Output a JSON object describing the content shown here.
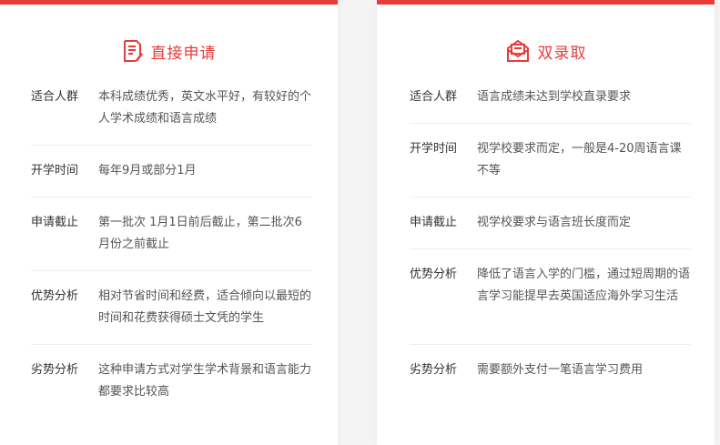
{
  "cards": [
    {
      "title": "直接申请",
      "icon": "application-form-icon",
      "rows": [
        {
          "label": "适合人群",
          "value": "本科成绩优秀，英文水平好，有较好的个人学术成绩和语言成绩"
        },
        {
          "label": "开学时间",
          "value": "每年9月或部分1月"
        },
        {
          "label": "申请截止",
          "value": "第一批次 1月1日前后截止，第二批次6月份之前截止"
        },
        {
          "label": "优势分析",
          "value": "相对节省时间和经费，适合倾向以最短的时间和花费获得硕士文凭的学生"
        },
        {
          "label": "劣势分析",
          "value": "这种申请方式对学生学术背景和语言能力都要求比较高"
        }
      ]
    },
    {
      "title": "双录取",
      "icon": "envelope-offer-icon",
      "rows": [
        {
          "label": "适合人群",
          "value": "语言成绩未达到学校直录要求"
        },
        {
          "label": "开学时间",
          "value": "视学校要求而定，一般是4-20周语言课不等"
        },
        {
          "label": "申请截止",
          "value": "视学校要求与语言班长度而定"
        },
        {
          "label": "优势分析",
          "value": "降低了语言入学的门槛，通过短周期的语言学习能提早去英国适应海外学习生活"
        },
        {
          "label": "劣势分析",
          "value": "需要额外支付一笔语言学习费用"
        }
      ]
    }
  ],
  "colors": {
    "accent": "#e83b3a",
    "label": "#333333",
    "text": "#555555",
    "divider": "#eeeeee",
    "background": "#f4f4f4"
  }
}
